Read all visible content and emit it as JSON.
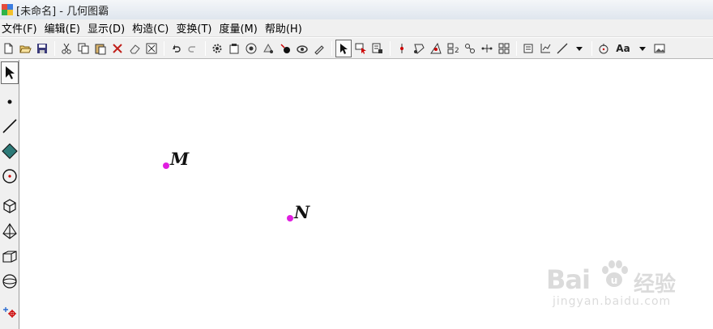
{
  "window": {
    "title": "[未命名] - 几何图霸"
  },
  "menubar": {
    "items": [
      "文件(F)",
      "编辑(E)",
      "显示(D)",
      "构造(C)",
      "变换(T)",
      "度量(M)",
      "帮助(H)"
    ]
  },
  "toolbar": {
    "text_style_label": "Aa",
    "icons": [
      "new-file-icon",
      "open-folder-icon",
      "save-icon",
      "cut-icon",
      "copy-icon",
      "paste-icon",
      "delete-icon",
      "eraser-icon",
      "hide-icon",
      "undo-icon",
      "redo-icon",
      "gear-icon",
      "properties-icon",
      "animate-icon",
      "color-icon",
      "point-icon",
      "trace-icon",
      "brush-icon",
      "select-arrow-icon",
      "select-label-icon",
      "text-icon",
      "point-on-object-icon",
      "intersection-icon",
      "midpoint-icon",
      "segment-icon",
      "perpendicular-icon",
      "parallel-icon",
      "grid-icon",
      "frame-icon",
      "axes-icon",
      "line-tool-icon",
      "dropdown-icon",
      "circle-center-icon",
      "text-style-icon",
      "image-icon"
    ]
  },
  "toolbox": {
    "tools": [
      "select-arrow-icon",
      "point-tool-icon",
      "segment-tool-icon",
      "polygon-tool-icon",
      "circle-tool-icon",
      "cube-tool-icon",
      "pyramid-tool-icon",
      "prism-tool-icon",
      "sphere-tool-icon",
      "custom-tool-icon"
    ]
  },
  "canvas": {
    "points": [
      {
        "label": "M",
        "color": "#e01ee0"
      },
      {
        "label": "N",
        "color": "#e01ee0"
      }
    ]
  },
  "watermark": {
    "logo": "Bai",
    "logo_suffix": "u",
    "text": "经验",
    "url": "jingyan.baidu.com"
  }
}
